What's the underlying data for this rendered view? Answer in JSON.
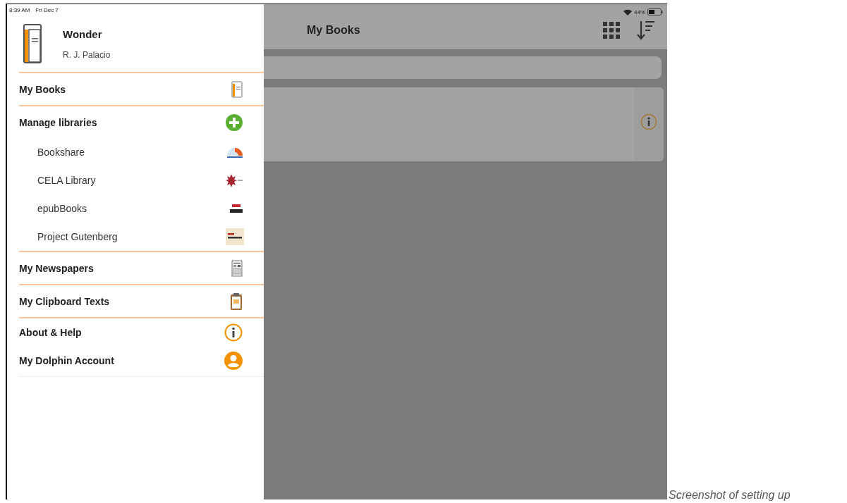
{
  "status_bar": {
    "time": "8:39 AM",
    "date": "Fri Dec 7",
    "battery": "44%"
  },
  "drawer": {
    "current_book": {
      "title": "Wonder",
      "author": "R. J. Palacio"
    },
    "groups": [
      {
        "items": [
          {
            "label": "My Books"
          }
        ]
      },
      {
        "items": [
          {
            "label": "Manage libraries",
            "children": [
              {
                "label": "Bookshare"
              },
              {
                "label": "CELA Library"
              },
              {
                "label": "epubBooks"
              },
              {
                "label": "Project Gutenberg"
              }
            ]
          }
        ]
      },
      {
        "items": [
          {
            "label": "My Newspapers"
          }
        ]
      },
      {
        "items": [
          {
            "label": "My Clipboard Texts"
          }
        ]
      },
      {
        "items": [
          {
            "label": "About & Help"
          },
          {
            "label": "My Dolphin Account"
          }
        ]
      }
    ]
  },
  "header": {
    "title": "My Books"
  },
  "caption": "Screenshot of setting up"
}
